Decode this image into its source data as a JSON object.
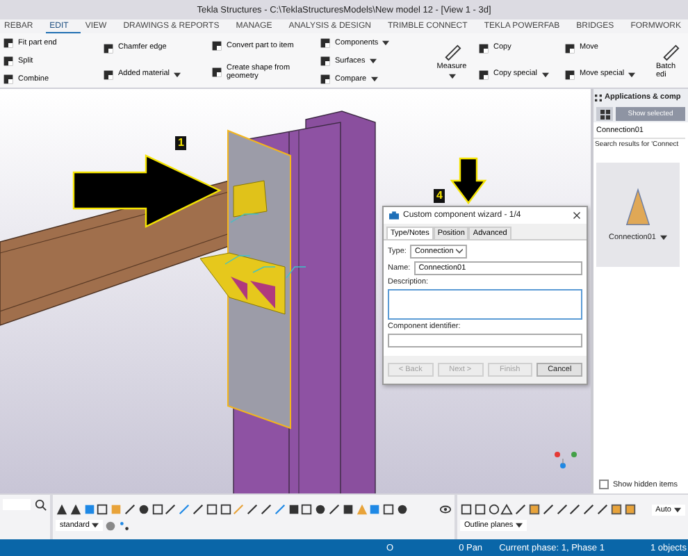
{
  "window": {
    "title": "Tekla Structures - C:\\TeklaStructuresModels\\New model 12  - [View 1 - 3d]"
  },
  "tabs": [
    {
      "label": "REBAR",
      "selected": false
    },
    {
      "label": "EDIT",
      "selected": true
    },
    {
      "label": "VIEW",
      "selected": false
    },
    {
      "label": "DRAWINGS & REPORTS",
      "selected": false
    },
    {
      "label": "MANAGE",
      "selected": false
    },
    {
      "label": "ANALYSIS & DESIGN",
      "selected": false
    },
    {
      "label": "TRIMBLE CONNECT",
      "selected": false
    },
    {
      "label": "TEKLA POWERFAB",
      "selected": false
    },
    {
      "label": "BRIDGES",
      "selected": false
    },
    {
      "label": "FORMWORK",
      "selected": false
    }
  ],
  "ribbon": {
    "columns": [
      [
        {
          "label": "Fit part end",
          "kind": "row",
          "dropdown": false
        },
        {
          "label": "Split",
          "kind": "row",
          "dropdown": false
        },
        {
          "label": "Combine",
          "kind": "row",
          "dropdown": false
        }
      ],
      [
        {
          "label": "Chamfer edge",
          "kind": "row",
          "dropdown": false
        },
        {
          "label": "Added material",
          "kind": "row",
          "dropdown": true
        }
      ],
      [
        {
          "label": "Convert part to item",
          "kind": "row",
          "dropdown": false
        },
        {
          "label": "Create shape from geometry",
          "kind": "row",
          "dropdown": false
        }
      ],
      [
        {
          "label": "Components",
          "kind": "row",
          "dropdown": true
        },
        {
          "label": "Surfaces",
          "kind": "row",
          "dropdown": true
        },
        {
          "label": "Compare",
          "kind": "row",
          "dropdown": true
        }
      ],
      [
        {
          "label": "Measure",
          "kind": "stacked",
          "dropdown": true
        }
      ],
      [
        {
          "label": "Copy",
          "kind": "row",
          "dropdown": false
        },
        {
          "label": "Copy special",
          "kind": "row",
          "dropdown": true
        }
      ],
      [
        {
          "label": "Move",
          "kind": "row",
          "dropdown": false
        },
        {
          "label": "Move special",
          "kind": "row",
          "dropdown": true
        }
      ],
      [
        {
          "label": "Batch edi",
          "kind": "stacked",
          "dropdown": false
        }
      ]
    ]
  },
  "callouts": [
    {
      "label": "1"
    },
    {
      "label": "4"
    }
  ],
  "dialog": {
    "title": "Custom component wizard - 1/4",
    "tabs": [
      {
        "label": "Type/Notes",
        "selected": true
      },
      {
        "label": "Position",
        "selected": false
      },
      {
        "label": "Advanced",
        "selected": false
      }
    ],
    "type_label": "Type:",
    "type_value": "Connection",
    "name_label": "Name:",
    "name_value": "Connection01",
    "description_label": "Description:",
    "identifier_label": "Component identifier:",
    "buttons": [
      {
        "label": "< Back",
        "disabled": true
      },
      {
        "label": "Next >",
        "disabled": true
      },
      {
        "label": "Finish",
        "disabled": true
      },
      {
        "label": "Cancel",
        "disabled": false
      }
    ]
  },
  "side_panel": {
    "title": "Applications & comp",
    "show_selected": {
      "label": "Show selected",
      "disabled": true
    },
    "search": {
      "value": "Connection01"
    },
    "results_caption": "Search results for 'Connect",
    "result": {
      "label": "Connection01"
    },
    "show_hidden": {
      "label": "Show hidden items",
      "checked": false
    }
  },
  "bottom_toolbar": {
    "representation": "standard",
    "auto": "Auto",
    "outline": "Outline planes"
  },
  "status_bar": {
    "items": [
      "O",
      "0 Pan",
      "Current phase: 1, Phase 1",
      "1 objects"
    ]
  }
}
